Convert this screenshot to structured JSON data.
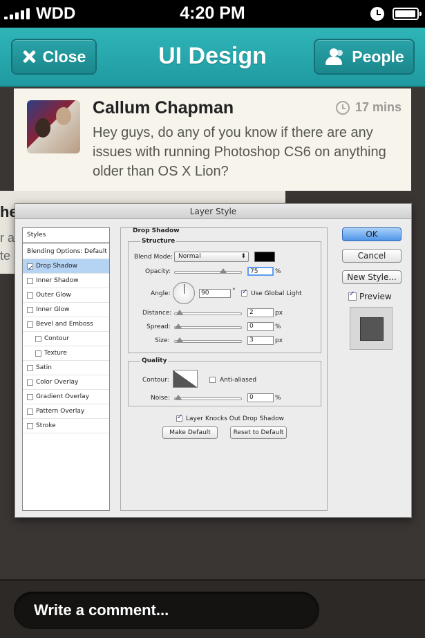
{
  "status_bar": {
    "carrier": "WDD",
    "time": "4:20 PM"
  },
  "nav": {
    "close_label": "Close",
    "title": "UI Design",
    "people_label": "People"
  },
  "post": {
    "author": "Callum Chapman",
    "time": "17 mins",
    "message": "Hey guys, do any of you know if there are any issues with running Photoshop CS6 on anything older than OS X Lion?"
  },
  "second_post": {
    "author_fragment": "he",
    "line1_fragment": "r a",
    "line2_fragment": "te"
  },
  "dialog": {
    "title": "Layer Style",
    "styles_header": "Styles",
    "styles": [
      {
        "label": "Blending Options: Default",
        "check": false
      },
      {
        "label": "Drop Shadow",
        "check": true
      },
      {
        "label": "Inner Shadow",
        "check": false
      },
      {
        "label": "Outer Glow",
        "check": false
      },
      {
        "label": "Inner Glow",
        "check": false
      },
      {
        "label": "Bevel and Emboss",
        "check": false
      },
      {
        "label": "Contour",
        "check": false
      },
      {
        "label": "Texture",
        "check": false
      },
      {
        "label": "Satin",
        "check": false
      },
      {
        "label": "Color Overlay",
        "check": false
      },
      {
        "label": "Gradient Overlay",
        "check": false
      },
      {
        "label": "Pattern Overlay",
        "check": false
      },
      {
        "label": "Stroke",
        "check": false
      }
    ],
    "section_title": "Drop Shadow",
    "structure": {
      "title": "Structure",
      "blend_mode_label": "Blend Mode:",
      "blend_mode_value": "Normal",
      "opacity_label": "Opacity:",
      "opacity_value": "75",
      "opacity_unit": "%",
      "opacity_fraction": 0.75,
      "angle_label": "Angle:",
      "angle_value": "90",
      "angle_unit": "°",
      "use_global_light": "Use Global Light",
      "distance_label": "Distance:",
      "distance_value": "2",
      "distance_unit": "px",
      "distance_fraction": 0.02,
      "spread_label": "Spread:",
      "spread_value": "0",
      "spread_unit": "%",
      "spread_fraction": 0.0,
      "size_label": "Size:",
      "size_value": "3",
      "size_unit": "px",
      "size_fraction": 0.02
    },
    "quality": {
      "title": "Quality",
      "contour_label": "Contour:",
      "anti_aliased": "Anti-aliased",
      "noise_label": "Noise:",
      "noise_value": "0",
      "noise_unit": "%",
      "noise_fraction": 0.0
    },
    "layer_knocks_out": "Layer Knocks Out Drop Shadow",
    "make_default": "Make Default",
    "reset_default": "Reset to Default",
    "ok": "OK",
    "cancel": "Cancel",
    "new_style": "New Style...",
    "preview": "Preview"
  },
  "comment": {
    "placeholder": "Write a comment..."
  },
  "colors": {
    "nav": "#2aaeb2",
    "shadow_color": "#000000",
    "selection": "#b5d4f4"
  }
}
